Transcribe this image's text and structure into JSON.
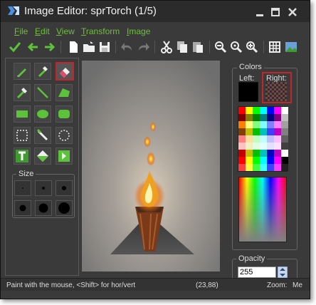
{
  "window": {
    "title": "Image Editor: sprTorch (1/5)"
  },
  "menu": [
    "File",
    "Edit",
    "View",
    "Transform",
    "Image"
  ],
  "toolbar": {
    "icons": [
      "checkmark-icon",
      "undo-arrow-icon",
      "redo-arrow-icon",
      "new-file-icon",
      "open-folder-icon",
      "save-icon",
      "undo-icon",
      "redo-icon",
      "cut-icon",
      "copy-icon",
      "paste-icon",
      "zoom-out-icon",
      "zoom-reset-icon",
      "zoom-in-icon",
      "grid-icon",
      "image-icon"
    ]
  },
  "tools": {
    "rows": [
      [
        "pencil-tool",
        "spray-tool",
        "eraser-tool"
      ],
      [
        "dropper-tool",
        "line-tool",
        "polygon-tool"
      ],
      [
        "rectangle-tool",
        "ellipse-tool",
        "rounded-rect-tool"
      ],
      [
        "select-rect-tool",
        "magic-wand-tool",
        "select-ellipse-tool"
      ],
      [
        "text-tool",
        "fill-tool",
        "change-color-tool"
      ]
    ],
    "active": "eraser-tool"
  },
  "size": {
    "label": "Size",
    "options": [
      1,
      2,
      3,
      4,
      5,
      6
    ]
  },
  "colors": {
    "label": "Colors",
    "left_label": "Left:",
    "right_label": "Right:",
    "left_color": "#000000",
    "palette": [
      "#ff0000",
      "#ffff00",
      "#00ff00",
      "#00ffff",
      "#0000ff",
      "#ff00ff",
      "#ffffff",
      "#800000",
      "#808000",
      "#008000",
      "#008080",
      "#000080",
      "#800080",
      "#c0c0c0",
      "#ff8000",
      "#ffff80",
      "#80ff80",
      "#80ffff",
      "#8080ff",
      "#ff80ff",
      "#a0a0a0",
      "#804000",
      "#c0c000",
      "#00c000",
      "#00c0c0",
      "#4040ff",
      "#c000c0",
      "#808080",
      "#ff8080",
      "#ffe0a0",
      "#c0ffc0",
      "#c0ffff",
      "#c0c0ff",
      "#ffc0ff",
      "#606060",
      "#ffc0c0",
      "#f0f0c0",
      "#e0ffe0",
      "#e0ffff",
      "#e0e0ff",
      "#ffe0ff",
      "#404040",
      "#c00000",
      "#c0c000",
      "#00c000",
      "#00c0c0",
      "#0000c0",
      "#c000c0",
      "#ffffff",
      "#ff0000",
      "#ffff00",
      "#00ff00",
      "#00ffff",
      "#0000ff",
      "#ff00ff",
      "#000000",
      "#ff4040",
      "#ffff40",
      "#40ff40",
      "#40ffff",
      "#4040ff",
      "#ff40ff",
      "#202020"
    ]
  },
  "opacity": {
    "label": "Opacity",
    "value": "255"
  },
  "status": {
    "hint": "Paint with the mouse, <Shift> for hor/vert",
    "coords": "(23,88)",
    "zoom_label": "Zoom:",
    "zoom_value": "Me"
  }
}
